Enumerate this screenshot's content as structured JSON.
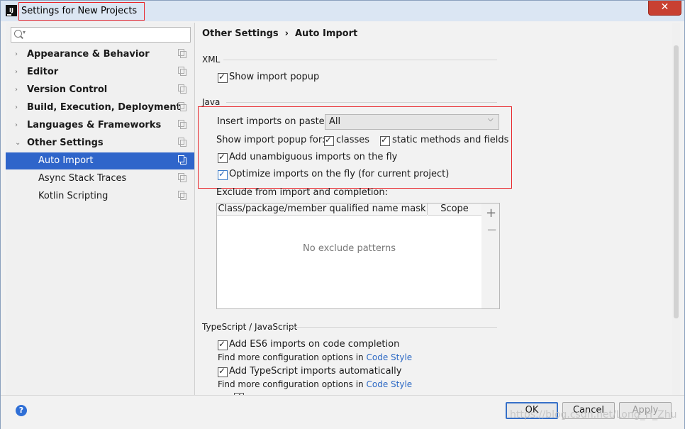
{
  "window": {
    "title": "Settings for New Projects"
  },
  "search": {
    "placeholder": ""
  },
  "sidebar": {
    "items": [
      {
        "label": "Appearance & Behavior"
      },
      {
        "label": "Editor"
      },
      {
        "label": "Version Control"
      },
      {
        "label": "Build, Execution, Deployment"
      },
      {
        "label": "Languages & Frameworks"
      },
      {
        "label": "Other Settings"
      },
      {
        "label": "Auto Import"
      },
      {
        "label": "Async Stack Traces"
      },
      {
        "label": "Kotlin Scripting"
      }
    ]
  },
  "breadcrumb": {
    "parent": "Other Settings",
    "separator": "›",
    "current": "Auto Import"
  },
  "xml": {
    "section": "XML",
    "show_popup": "Show import popup"
  },
  "java": {
    "section": "Java",
    "insert_label": "Insert imports on paste:",
    "insert_value": "All",
    "popup_label": "Show import popup for:",
    "classes": "classes",
    "static": "static methods and fields",
    "add_unambiguous": "Add unambiguous imports on the fly",
    "optimize": "Optimize imports on the fly (for current project)",
    "exclude_label": "Exclude from import and completion:",
    "col_mask": "Class/package/member qualified name mask",
    "col_scope": "Scope",
    "empty": "No exclude patterns"
  },
  "ts": {
    "section": "TypeScript / JavaScript",
    "es6": "Add ES6 imports on code completion",
    "more1": "Find more configuration options in ",
    "code_style": "Code Style",
    "ts_auto": "Add TypeScript imports automatically",
    "more2": "Find more configuration options in "
  },
  "buttons": {
    "ok": "OK",
    "cancel": "Cancel",
    "apply": "Apply",
    "help": "?"
  },
  "watermark": "https://blog.csdn.net/Long_H_Zhu",
  "colors": {
    "selection": "#2f65ca",
    "highlight_box": "#e8262b",
    "link": "#2b68c4"
  }
}
